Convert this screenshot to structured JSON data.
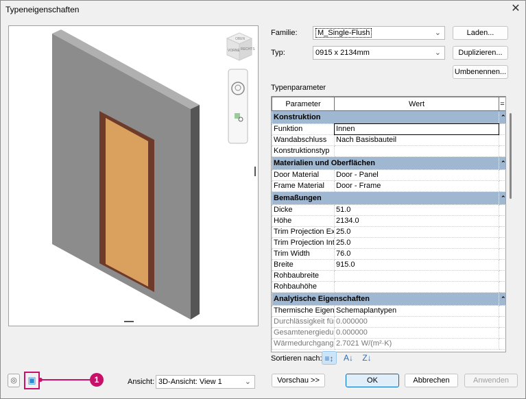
{
  "window": {
    "title": "Typeneigenschaften",
    "close_icon": "close-icon"
  },
  "form": {
    "family_label": "Familie:",
    "family_value": "M_Single-Flush",
    "type_label": "Typ:",
    "type_value": "0915 x 2134mm",
    "load_button": "Laden...",
    "duplicate_button": "Duplizieren...",
    "rename_button": "Umbenennen...",
    "type_params_label": "Typenparameter"
  },
  "grid": {
    "headers": [
      "Parameter",
      "Wert",
      "="
    ],
    "groups": [
      {
        "name": "Konstruktion",
        "rows": [
          [
            "Funktion",
            "Innen"
          ],
          [
            "Wandabschluss",
            "Nach Basisbauteil"
          ],
          [
            "Konstruktionstyp",
            ""
          ]
        ]
      },
      {
        "name": "Materialien und Oberflächen",
        "rows": [
          [
            "Door Material",
            "Door - Panel"
          ],
          [
            "Frame Material",
            "Door - Frame"
          ]
        ]
      },
      {
        "name": "Bemaßungen",
        "rows": [
          [
            "Dicke",
            "51.0"
          ],
          [
            "Höhe",
            "2134.0"
          ],
          [
            "Trim Projection Ex",
            "25.0"
          ],
          [
            "Trim Projection Int",
            "25.0"
          ],
          [
            "Trim Width",
            "76.0"
          ],
          [
            "Breite",
            "915.0"
          ],
          [
            "Rohbaubreite",
            ""
          ],
          [
            "Rohbauhöhe",
            ""
          ]
        ]
      },
      {
        "name": "Analytische Eigenschaften",
        "rows": [
          [
            "Thermische Eigens",
            "Schemaplantypen"
          ],
          [
            "Durchlässigkeit für",
            "0.000000"
          ],
          [
            "Gesamtenergiedur",
            "0.000000"
          ],
          [
            "Wärmedurchgang",
            "2.7021 W/(m²·K)"
          ]
        ]
      }
    ]
  },
  "sort": {
    "label": "Sortieren nach:"
  },
  "footer": {
    "preview_button": "Vorschau >>",
    "ok_button": "OK",
    "cancel_button": "Abbrechen",
    "apply_button": "Anwenden",
    "view_label": "Ansicht:",
    "view_value": "3D-Ansicht: View 1",
    "callout": "1"
  },
  "viewcube": {
    "front": "VORNE",
    "right": "RECHTS",
    "top": "OBEN"
  },
  "colors": {
    "wall_front": "#8c8c8c",
    "wall_side": "#555555",
    "door_frame": "#6e3b2a",
    "door_panel": "#d9a05e",
    "callout": "#c8106b",
    "group_header": "#9fb7d1"
  }
}
